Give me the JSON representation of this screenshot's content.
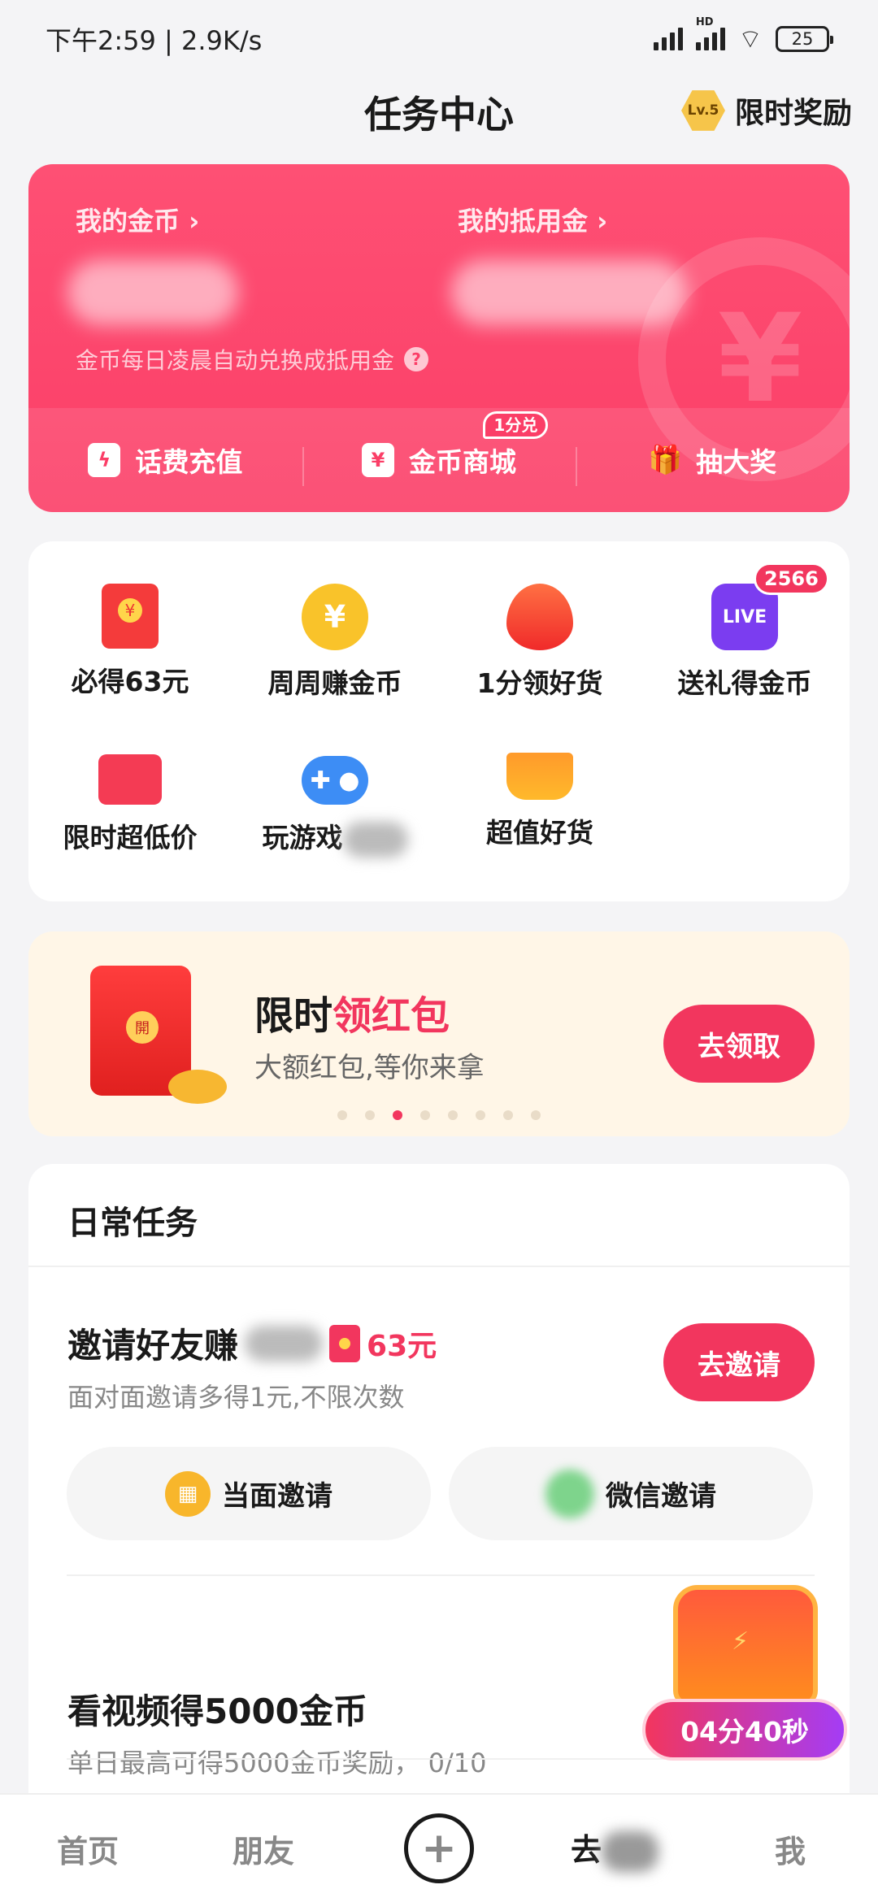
{
  "status_bar": {
    "time": "下午2:59 | 2.9K/s",
    "battery": "25",
    "hd": "HD"
  },
  "header": {
    "title": "任务中心",
    "level_badge": "Lv.5",
    "reward_label": "限时奖励"
  },
  "coin_card": {
    "my_coins_label": "我的金币 ›",
    "my_voucher_label": "我的抵用金 ›",
    "note": "金币每日凌晨自动兑换成抵用金",
    "actions": [
      {
        "label": "话费充值",
        "icon": "phone-charge-icon",
        "glyph": "ϟ"
      },
      {
        "label": "金币商城",
        "icon": "coin-mall-icon",
        "glyph": "¥",
        "badge": "1分兑"
      },
      {
        "label": "抽大奖",
        "icon": "gift-icon",
        "glyph": "🎁"
      }
    ]
  },
  "quick_grid": {
    "items": [
      {
        "label": "必得63元",
        "icon": "red-packet-icon"
      },
      {
        "label": "周周赚金币",
        "icon": "coin-icon",
        "glyph": "¥"
      },
      {
        "label": "1分领好货",
        "icon": "fire-icon"
      },
      {
        "label": "送礼得金币",
        "icon": "live-icon",
        "glyph": "LIVE",
        "badge": "2566"
      },
      {
        "label": "限时超低价",
        "icon": "gift-box-icon"
      },
      {
        "label": "玩游戏",
        "icon": "gamepad-icon",
        "glyph": "✚ ●"
      },
      {
        "label": "超值好货",
        "icon": "cart-icon"
      }
    ]
  },
  "banner": {
    "title_prefix": "限时",
    "title_highlight": "领红包",
    "subtitle": "大额红包,等你来拿",
    "button": "去领取",
    "dots_total": 8,
    "dots_active": 3
  },
  "daily_tasks": {
    "header": "日常任务",
    "invite": {
      "title": "邀请好友赚",
      "amount": "63元",
      "subtitle": "面对面邀请多得1元,不限次数",
      "button": "去邀请",
      "face_invite": "当面邀请",
      "wechat_invite": "微信邀请"
    },
    "video": {
      "title": "看视频得5000金币",
      "subtitle": "单日最高可得5000金币奖励， 0/10"
    }
  },
  "floating_chest": {
    "countdown": "04分40秒"
  },
  "bottom_nav": {
    "items": [
      "首页",
      "朋友",
      "去",
      "我"
    ]
  }
}
